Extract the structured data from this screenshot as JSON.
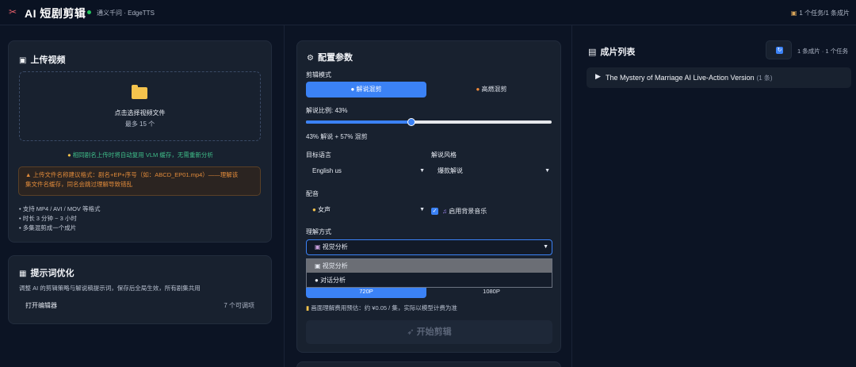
{
  "header": {
    "logo_icon": "scissors-icon",
    "title": "AI 短剧剪辑",
    "status": "通义千问 · EdgeTTS",
    "summary": "1 个任务/1 条成片"
  },
  "upload": {
    "title": "上传视频",
    "dropzone_main": "点击选择视频文件",
    "dropzone_sub": "最多 15 个",
    "cache_tip": "相同剧名上传时将自动复用 VLM 缓存，无需重新分析",
    "warning_line1": "上传文件名称建议格式：剧名+EP+序号（如：ABCD_EP01.mp4）——理解该",
    "warning_line2": "集文件名缓存，同名会跳过理解导致错乱",
    "bullets": [
      "• 支持 MP4 / AVI / MOV 等格式",
      "• 时长 3 分钟 ~ 3 小时",
      "• 多集混剪成一个成片"
    ]
  },
  "prompt": {
    "title": "提示词优化",
    "description": "调整 AI 的剪辑策略与解说稿提示词，保存后全局生效，所有剧集共用",
    "open_editor": "打开编辑器",
    "count": "7 个可调项"
  },
  "config": {
    "title": "配置参数",
    "mode_label": "剪辑模式",
    "mode_options": [
      "解说混剪",
      "高燃混剪"
    ],
    "mode_selected": "解说混剪",
    "ratio_label": "解说比例: 43%",
    "ratio_value": 43,
    "ratio_text": "43% 解说 + 57% 混剪",
    "language_label": "目标语言",
    "language_value": "English us",
    "style_label": "解说风格",
    "style_value": "爆款解说",
    "voice_label": "配音",
    "voice_value": "女声",
    "bgm_label": "启用背景音乐",
    "bgm_checked": true,
    "understand_label": "理解方式",
    "understand_value": "视觉分析",
    "understand_options": [
      "视觉分析",
      "对话分析"
    ],
    "resolution_options": [
      "720P",
      "1080P"
    ],
    "resolution_selected": "720P",
    "cost_note": "画面理解费用预估：约 ¥0.05 / 集，实际以模型计费为准",
    "start_button": "开始剪辑"
  },
  "films": {
    "title": "成片列表",
    "count": "1 条成片 · 1 个任务",
    "items": [
      {
        "name": "The Mystery of Marriage AI Live-Action Version",
        "count": "(1 条)"
      }
    ]
  },
  "colors": {
    "background": "#0c1424",
    "card": "#18212f",
    "accent": "#3b82f6",
    "status_ok": "#22c55e",
    "warning": "#e08a3a",
    "tip": "#3fbf8a"
  }
}
